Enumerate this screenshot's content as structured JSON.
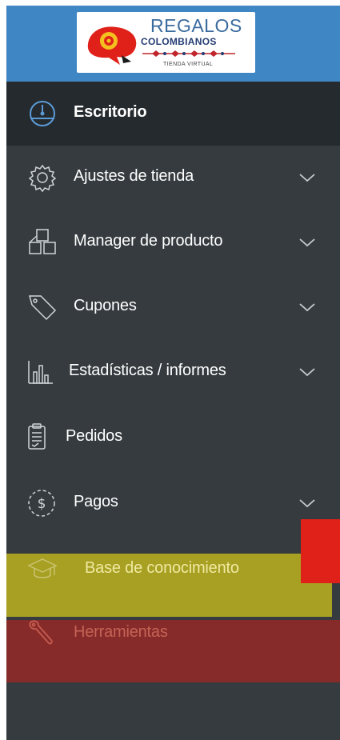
{
  "logo": {
    "brand": "REGALOS",
    "subtitle": "COLOMBIANOS",
    "tagline": "TIENDA VIRTUAL"
  },
  "menu": [
    {
      "label": "Escritorio",
      "icon": "dashboard-icon",
      "has_submenu": false,
      "active": true
    },
    {
      "label": "Ajustes de tienda",
      "icon": "gear-icon",
      "has_submenu": true
    },
    {
      "label": "Manager de producto",
      "icon": "boxes-icon",
      "has_submenu": true
    },
    {
      "label": "Cupones",
      "icon": "tag-icon",
      "has_submenu": true
    },
    {
      "label": "Estadísticas / informes",
      "icon": "bar-chart-icon",
      "has_submenu": true
    },
    {
      "label": "Pedidos",
      "icon": "clipboard-icon",
      "has_submenu": false
    },
    {
      "label": "Pagos",
      "icon": "dollar-circle-icon",
      "has_submenu": true
    },
    {
      "label": "Base de conocimiento",
      "icon": "graduation-cap-icon",
      "has_submenu": false
    },
    {
      "label": "Herramientas",
      "icon": "wrench-icon",
      "has_submenu": false
    }
  ],
  "colors": {
    "header_bg": "#3f86c5",
    "sidebar_bg": "#353b3f",
    "active_bg": "#252a2e",
    "text": "#ffffff",
    "highlight_yellow": "#a8a022",
    "highlight_red": "#872b2a",
    "marker_red": "#e0211a"
  }
}
